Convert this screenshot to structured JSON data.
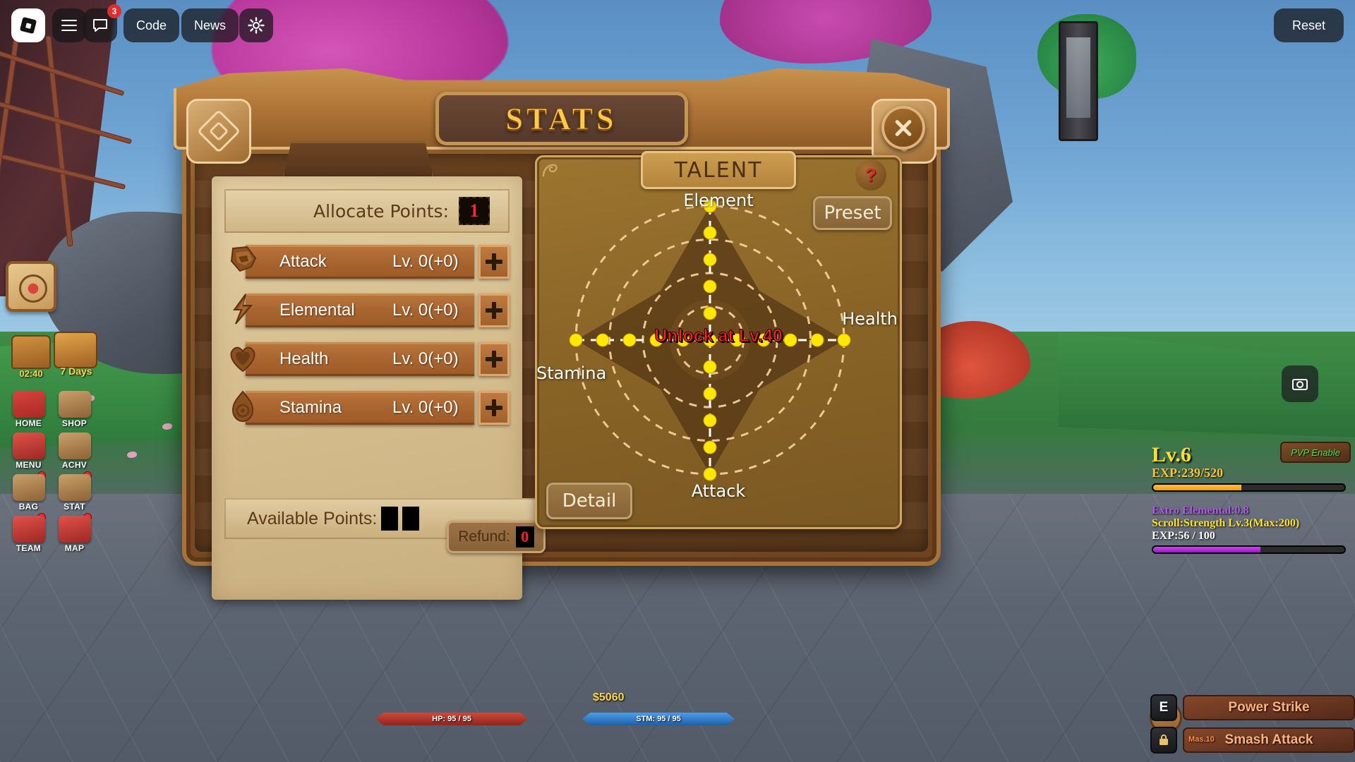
{
  "topbar": {
    "logo_icon": "roblox-logo-icon",
    "menu_icon": "hamburger-menu-icon",
    "chat_icon": "chat-icon",
    "chat_badge": "3",
    "code_label": "Code",
    "news_label": "News",
    "settings_icon": "gear-icon",
    "reset_label": "Reset"
  },
  "left_hud": {
    "compass_icon": "compass-icon",
    "chest_icon": "treasure-chest-icon",
    "chest_timer": "02:40",
    "sevendays_icon": "calendar-icon",
    "sevendays_label": "7 Days",
    "buttons": [
      {
        "label": "HOME",
        "icon": "home-icon",
        "has_dot": false
      },
      {
        "label": "SHOP",
        "icon": "cart-icon",
        "has_dot": false
      },
      {
        "label": "MENU",
        "icon": "menu-icon",
        "has_dot": true
      },
      {
        "label": "ACHV",
        "icon": "trophy-icon",
        "has_dot": false
      },
      {
        "label": "BAG",
        "icon": "bag-icon",
        "has_dot": true
      },
      {
        "label": "STAT",
        "icon": "stat-icon",
        "has_dot": true
      },
      {
        "label": "TEAM",
        "icon": "team-icon",
        "has_dot": true
      },
      {
        "label": "MAP",
        "icon": "map-icon",
        "has_dot": true
      }
    ]
  },
  "window": {
    "title": "STATS",
    "close_icon": "close-icon"
  },
  "stats_panel": {
    "allocate_label": "Allocate Points:",
    "allocate_value": "1",
    "rows": [
      {
        "name": "Attack",
        "level": "Lv.  0(+0)",
        "icon": "sword-icon",
        "plus_icon": "plus-icon"
      },
      {
        "name": "Elemental",
        "level": "Lv.  0(+0)",
        "icon": "lightning-icon",
        "plus_icon": "plus-icon"
      },
      {
        "name": "Health",
        "level": "Lv.  0(+0)",
        "icon": "heart-icon",
        "plus_icon": "plus-icon"
      },
      {
        "name": "Stamina",
        "level": "Lv.  0(+0)",
        "icon": "flame-icon",
        "plus_icon": "plus-icon"
      }
    ],
    "available_label": "Available Points:",
    "available_value": "",
    "refund_label": "Refund:",
    "refund_value": "0"
  },
  "talent_panel": {
    "tab_label": "TALENT",
    "help_icon": "question-mark-icon",
    "preset_label": "Preset",
    "detail_label": "Detail",
    "unlock_text": "Unlock at Lv.40"
  },
  "chart_data": {
    "type": "radar",
    "title": "TALENT",
    "categories": [
      "Element",
      "Health",
      "Attack",
      "Stamina"
    ],
    "axis_labels": {
      "top": "Element",
      "right": "Health",
      "bottom": "Attack",
      "left": "Stamina"
    },
    "rings": 4,
    "nodes_per_axis": 5,
    "values": [
      0,
      0,
      0,
      0
    ],
    "node_color": "#ffe800",
    "ring_color": "#f3cf9a",
    "locked": true,
    "lock_message": "Unlock at Lv.40"
  },
  "bottom_hud": {
    "money": "$5060",
    "hp_label": "HP: 95 / 95",
    "hp_color": "#b8332a",
    "stm_label": "STM: 95 / 95",
    "stm_color": "#2f7fd6"
  },
  "right_hud": {
    "level": "Lv.6",
    "exp_text": "EXP:239/520",
    "exp_percent": 46,
    "pvp_label": "PVP Enable",
    "extro_elemental": "Extro Elemental:0.8",
    "scroll_text": "Scroll:Strength Lv.3(Max:200)",
    "scroll_exp": "EXP:56 / 100",
    "scroll_percent": 56,
    "camera_icon": "camera-icon",
    "search_icon": "search-icon",
    "skills": [
      {
        "key": "E",
        "name": "Power Strike",
        "mas": "",
        "locked": false
      },
      {
        "key": "",
        "name": "Smash Attack",
        "mas": "Mas.10",
        "locked": true
      }
    ]
  }
}
